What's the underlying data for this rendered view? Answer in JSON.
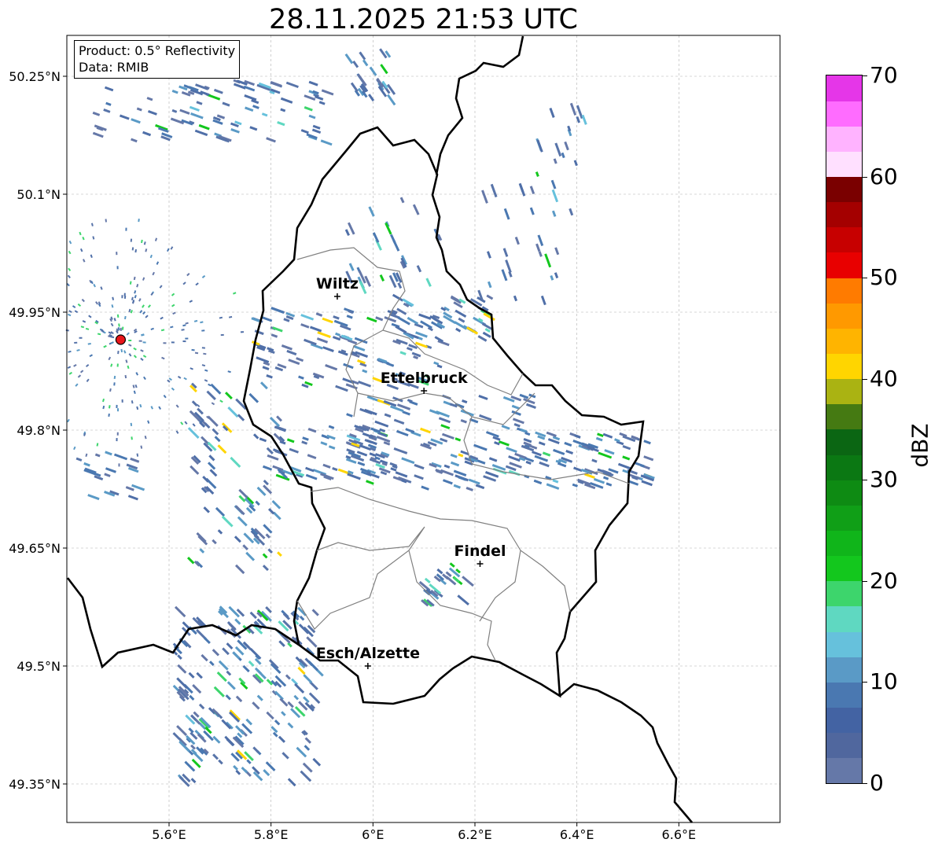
{
  "title": "28.11.2025 21:53 UTC",
  "info": {
    "product": "Product: 0.5° Reflectivity",
    "data": "Data: RMIB"
  },
  "map": {
    "lon_range": [
      5.4,
      6.8
    ],
    "lat_range": [
      49.3,
      50.3
    ],
    "lon_ticks": [
      {
        "value": 5.6,
        "label": "5.6°E"
      },
      {
        "value": 5.8,
        "label": "5.8°E"
      },
      {
        "value": 6.0,
        "label": "6°E"
      },
      {
        "value": 6.2,
        "label": "6.2°E"
      },
      {
        "value": 6.4,
        "label": "6.4°E"
      },
      {
        "value": 6.6,
        "label": "6.6°E"
      }
    ],
    "lat_ticks": [
      {
        "value": 50.25,
        "label": "50.25°N"
      },
      {
        "value": 50.1,
        "label": "50.1°N"
      },
      {
        "value": 49.95,
        "label": "49.95°N"
      },
      {
        "value": 49.8,
        "label": "49.8°N"
      },
      {
        "value": 49.65,
        "label": "49.65°N"
      },
      {
        "value": 49.5,
        "label": "49.5°N"
      },
      {
        "value": 49.35,
        "label": "49.35°N"
      }
    ],
    "cities": [
      {
        "name": "Wiltz",
        "lon": 5.93,
        "lat": 49.97
      },
      {
        "name": "Ettelbruck",
        "lon": 6.1,
        "lat": 49.85
      },
      {
        "name": "Findel",
        "lon": 6.21,
        "lat": 49.63
      },
      {
        "name": "Esch/Alzette",
        "lon": 5.99,
        "lat": 49.5
      }
    ],
    "radar_site": {
      "lon": 5.505,
      "lat": 49.915,
      "color": "#e8161b"
    },
    "border_color": "#000000",
    "canton_color": "#808080",
    "grid_color": "#b0b0b0"
  },
  "colorbar": {
    "unit": "dBZ",
    "min": 0,
    "max": 70,
    "ticks": [
      0,
      10,
      20,
      30,
      40,
      50,
      60,
      70
    ],
    "colors": [
      "#6578a8",
      "#50679e",
      "#4363a3",
      "#4a78b1",
      "#5a9ac6",
      "#66c1dc",
      "#5fd8c1",
      "#3dd56c",
      "#13c71d",
      "#10b51a",
      "#109f17",
      "#0e8b13",
      "#0b7813",
      "#0b6613",
      "#457a12",
      "#aab312",
      "#ffd500",
      "#ffb400",
      "#ff9900",
      "#ff7b00",
      "#e80000",
      "#c70000",
      "#a40000",
      "#7a0000",
      "#ffe0ff",
      "#ffb3ff",
      "#ff6cff",
      "#e536e8"
    ]
  }
}
